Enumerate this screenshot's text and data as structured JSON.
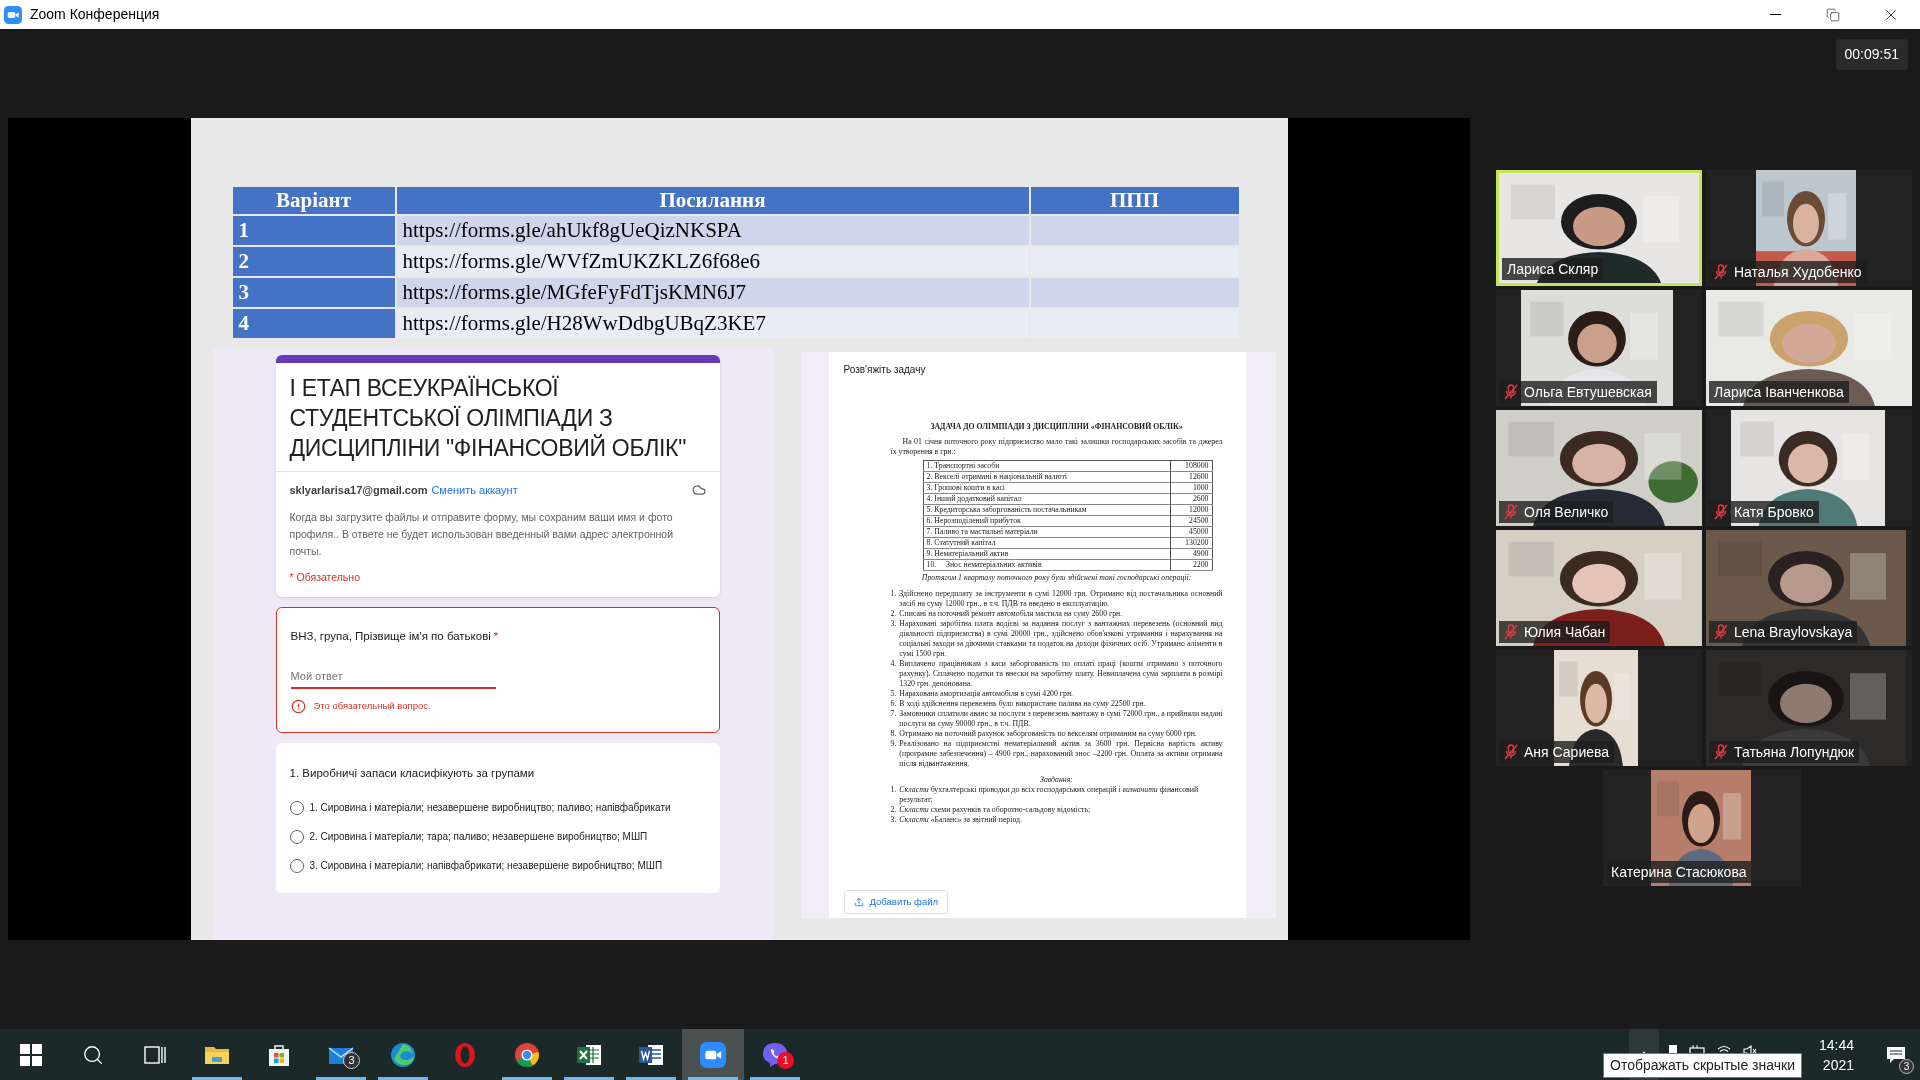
{
  "window": {
    "title": "Zoom Конференция"
  },
  "timer": "00:09:51",
  "slide": {
    "table": {
      "columns": [
        "Варіант",
        "Посилання",
        "ППП"
      ],
      "rows": [
        {
          "variant": "1",
          "link": "https://forms.gle/ahUkf8gUeQizNKSPA"
        },
        {
          "variant": "2",
          "link": "https://forms.gle/WVfZmUKZKLZ6f68e6"
        },
        {
          "variant": "3",
          "link": "https://forms.gle/MGfeFyFdTjsKMN6J7"
        },
        {
          "variant": "4",
          "link": "https://forms.gle/H28WwDdbgUBqZ3KE7"
        }
      ]
    },
    "form": {
      "title": "І ЕТАП ВСЕУКРАЇНСЬКОЇ СТУДЕНТСЬКОЇ ОЛІМПІАДИ З ДИСЦИПЛІНИ \"ФІНАНСОВИЙ ОБЛІК\"",
      "account_email": "sklyarlarisa17@gmail.com",
      "switch_account": "Сменить аккаунт",
      "notice": "Когда вы загрузите файлы и отправите форму, мы сохраним ваши имя и фото профиля.. В ответе не будет использован введенный вами адрес электронной почты.",
      "required_note": "* Обязательно",
      "question": {
        "label": "ВНЗ, група, Прізвище ім'я по батькові",
        "required_mark": "*",
        "placeholder": "Мой ответ",
        "error": "Это обязательный вопрос."
      },
      "question_2": {
        "label": "1. Виробничі запаси класифікують за групами",
        "options": [
          {
            "label": "1. Сировина і матеріали; незавершене виробництво; паливо; напівфабрикати",
            "selected": false
          },
          {
            "label": "2. Сировина і матеріали; тара; паливо; незавершене виробництво; МШП",
            "selected": false
          },
          {
            "label": "3. Сировина і матеріали; напівфабрикати; незавершене виробництво; МШП",
            "selected": false
          }
        ]
      }
    },
    "task": {
      "label": "Розв'яжіть задачу",
      "document": {
        "title": "ЗАДАЧА ДО ОЛІМПІАДИ З ДИСЦИПЛІНИ «ФІНАНСОВИЙ ОБЛІК»",
        "intro": "На 01 січня поточного року підприємство мало такі залишки господарських засобів та джерел їх утворення в грн.:",
        "balances": [
          {
            "label": "1. Транспортні засоби",
            "value": "108000"
          },
          {
            "label": "2. Векселі отримані в національній валюті",
            "value": "12600"
          },
          {
            "label": "3. Грошові кошти в касі",
            "value": "1000"
          },
          {
            "label": "4. Інший додатковий капітал",
            "value": "2600"
          },
          {
            "label": "5. Кредиторська заборгованість постачальникам",
            "value": "12000"
          },
          {
            "label": "6. Нерозподілений прибуток",
            "value": "24500"
          },
          {
            "label": "7. Паливо та мастильні матеріали",
            "value": "45000"
          },
          {
            "label": "8. Статутний капітал",
            "value": "130200"
          },
          {
            "label": "9. Нематеріальний актив",
            "value": "4900"
          },
          {
            "label": "10.     Знос нематеріальних активів",
            "value": "2200"
          }
        ],
        "operations_heading": "Протягом 1 кварталу поточного року були здійснені такі господарські операції:",
        "operations": [
          {
            "number": "1.",
            "text": "Здійснено передплату за інструменти в сумі 12000 грн. Отримано від постачальника основний засіб на суму 12000 грн., в т.ч. ПДВ та введено в експлуатацію."
          },
          {
            "number": "2.",
            "text": "Списані на поточний ремонт автомобіля мастила на суму 2600 грн."
          },
          {
            "number": "3.",
            "text": "Нараховані заробітна плата водієві за надання послуг з вантажних перевезень (основний вид діяльності підприємства) в сумі 20000 грн., здійснено обов'язкові утримання і нарахування на соціальні заходи за діючими ставками та податок на доходи фізичних осіб. Утримано аліменти в сумі 1500 грн."
          },
          {
            "number": "4.",
            "text": "Виплачено працівникам з каси заборгованість по оплаті праці (кошти отримано з поточного рахунку). Сплачено податки та внески на заробітну плату. Невиплачена сума зарплати в розмірі 1320 грн. депонована."
          },
          {
            "number": "5.",
            "text": "Нарахована амортизація автомобіля в сумі 4200 грн."
          },
          {
            "number": "6.",
            "text": "В ході здійснення перевезень було використане палива на суму 22500 грн."
          },
          {
            "number": "7.",
            "text": "Замовники сплатили аванс за послуги з перевезень вантажу в сумі 72000 грн., а прийняли надані послуги на суму 90000 грн., в т.ч. ПДВ."
          },
          {
            "number": "8.",
            "text": "Отримано на поточний рахунок заборгованість по векселям отриманим на суму 6000 грн."
          },
          {
            "number": "9.",
            "text": "Реалізовано на підприємстві нематеріальний актив за 3600 грн. Первісна вартість активу (програмне забезпечення) – 4900 грн., нарахований знос –2200 грн. Оплата за активи отримана після відвантаження."
          }
        ],
        "tasks_heading": "Завдання:",
        "tasks": [
          {
            "number": "1.",
            "text": "*Скласти* бухгалтерські проводки до всіх господарських операцій і *визначити* фінансовий результат;"
          },
          {
            "number": "2.",
            "text": "*Скласти* схеми рахунків та оборотно-сальдову відомість;"
          },
          {
            "number": "3.",
            "text": "*Скласти* «Баланс» за звітний період."
          }
        ]
      },
      "upload_button": "Добавить файл"
    }
  },
  "participants": [
    {
      "name": "Лариса Скляр",
      "muted": false,
      "speaking": true
    },
    {
      "name": "Наталья Худобенко",
      "muted": true,
      "speaking": false
    },
    {
      "name": "Ольга Евтушевская",
      "muted": true,
      "speaking": false
    },
    {
      "name": "Лариса Іванченкова",
      "muted": false,
      "speaking": false
    },
    {
      "name": "Оля Величко",
      "muted": true,
      "speaking": false
    },
    {
      "name": "Катя Бровко",
      "muted": true,
      "speaking": false
    },
    {
      "name": "Юлия Чабан",
      "muted": true,
      "speaking": false
    },
    {
      "name": "Lena Braylovskaya",
      "muted": true,
      "speaking": false
    },
    {
      "name": "Аня Сариева",
      "muted": true,
      "speaking": false
    },
    {
      "name": "Татьяна Лопундюк",
      "muted": true,
      "speaking": false
    },
    {
      "name": "Катерина Стасюкова",
      "muted": false,
      "speaking": false
    }
  ],
  "taskbar": {
    "apps": [
      {
        "kind": "start",
        "running": false,
        "active": false
      },
      {
        "kind": "search",
        "running": false,
        "active": false
      },
      {
        "kind": "taskview",
        "running": false,
        "active": false
      },
      {
        "kind": "explorer",
        "running": true,
        "active": false
      },
      {
        "kind": "store",
        "running": false,
        "active": false
      },
      {
        "kind": "mail",
        "running": true,
        "active": false,
        "badge": "3"
      },
      {
        "kind": "edge",
        "running": true,
        "active": false
      },
      {
        "kind": "opera",
        "running": false,
        "active": false
      },
      {
        "kind": "chrome",
        "running": true,
        "active": false
      },
      {
        "kind": "excel",
        "running": true,
        "active": false
      },
      {
        "kind": "word",
        "running": true,
        "active": false
      },
      {
        "kind": "zoom",
        "running": true,
        "active": true
      },
      {
        "kind": "viber",
        "running": true,
        "active": false,
        "badge": "1"
      }
    ],
    "tray": {
      "time": "14:44",
      "date": "2021",
      "notifications": "3",
      "tooltip": "Отображать скрытые значки"
    }
  }
}
